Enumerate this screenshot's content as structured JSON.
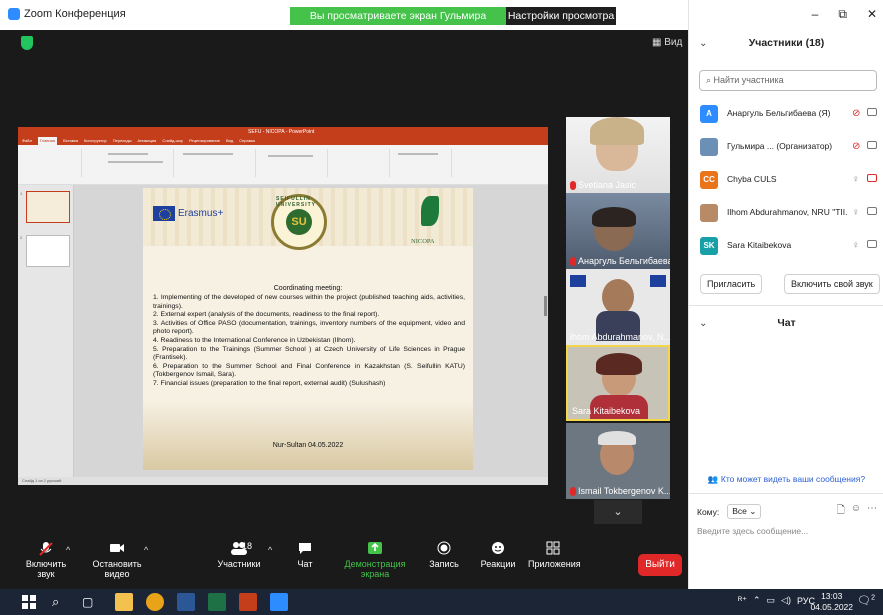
{
  "window": {
    "app_title": "Zoom Конференция",
    "view_banner": "Вы просматриваете экран Гульмира Сатыбалдиева",
    "view_settings": "Настройки просмотра",
    "view_button": "Вид",
    "win_controls": [
      "–",
      "⧉",
      "✕"
    ]
  },
  "shared_screen": {
    "ppt_title": "SEFU - NICOPA - PowerPoint",
    "ribbon_tabs": [
      "Файл",
      "Главная",
      "Вставка",
      "Конструктор",
      "Переходы",
      "Анимация",
      "Слайд-шоу",
      "Рецензирование",
      "Вид",
      "Справка"
    ],
    "slide": {
      "erasmus": "Erasmus+",
      "seal_text": "SEIFULLIN UNIVERSITY",
      "seal_letters": "SU",
      "nicopa": "NICOPA",
      "heading": "Coordinating meeting:",
      "items": [
        "1.  Implementing of the developed of new courses within the project (published teaching aids, activities, trainings).",
        "2.  External expert (analysis of the documents, readiness to the final report).",
        "3. Activities of Office PASO (documentation, trainings, inventory numbers of the equipment, video and photo report).",
        "4. Readiness to the International Conference in Uzbekistan (Ilhom).",
        "5. Preparation to the Trainings (Summer School ) at Czech University of Life Sciences in Prague (Frantisek).",
        "6. Preparation to the Summer School and Final Conference in Kazakhstan (S. Seifullin KATU) (Tokbergenov Ismail, Sara).",
        "7. Financial issues (preparation to the final report, external audit) (Sulushash)"
      ],
      "footer": "Nur-Sultan   04.05.2022"
    },
    "status_left": "Слайд 1 из 2   русский",
    "thumb_nums": [
      "1",
      "2"
    ]
  },
  "videos": [
    {
      "name": "Svetlana Jasic",
      "muted": true
    },
    {
      "name": "Анаргуль Бельгибаева",
      "muted": true
    },
    {
      "name": "lhom Abdurahmanov, N...",
      "muted": false
    },
    {
      "name": "Sara Kitaibekova",
      "muted": false,
      "active": true
    },
    {
      "name": "Ismail Tokbergenov K...",
      "muted": true
    }
  ],
  "toolbar": {
    "unmute": "Включить звук",
    "stop_video": "Остановить видео",
    "participants": "Участники",
    "participants_count": "18",
    "chat": "Чат",
    "share": "Демонстрация экрана",
    "record": "Запись",
    "reactions": "Реакции",
    "apps": "Приложения",
    "leave": "Выйти"
  },
  "panel": {
    "participants_title": "Участники (18)",
    "search_placeholder": "Найти участника",
    "participants": [
      {
        "initials": "A",
        "name": "Анаргуль Бельгибаева (Я)",
        "color": "#2d8cff",
        "mic_muted": true,
        "cam_off": false
      },
      {
        "initials": "",
        "name": "Гульмира ...  (Организатор)",
        "color": "#6b8fb5",
        "mic_muted": true,
        "cam_off": false
      },
      {
        "initials": "CC",
        "name": "Chyba CULS",
        "color": "#e8741c",
        "mic_muted": false,
        "cam_off": true
      },
      {
        "initials": "",
        "name": "Ilhom Abdurahmanov, NRU \"TII...",
        "color": "#b88a66",
        "mic_muted": false,
        "cam_off": false
      },
      {
        "initials": "SK",
        "name": "Sara Kitaibekova",
        "color": "#18a0a8",
        "mic_muted": false,
        "cam_off": false
      }
    ],
    "invite": "Пригласить",
    "unmute_self": "Включить свой звук",
    "chat_title": "Чат",
    "chat_visibility": "Кто может видеть ваши сообщения?",
    "to_label": "Кому:",
    "to_value": "Все",
    "chat_placeholder": "Введите здесь сообщение..."
  },
  "taskbar": {
    "lang": "РУС",
    "time": "13:03",
    "date": "04.05.2022",
    "notif_count": "2"
  },
  "colors": {
    "zoom_blue": "#2d8cff",
    "green": "#44c24a",
    "red": "#e02828",
    "ppt_orange": "#c43e1c"
  }
}
